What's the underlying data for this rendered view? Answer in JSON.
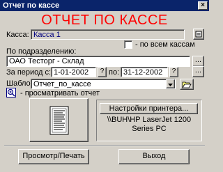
{
  "window": {
    "title": "Отчет по кассе",
    "close": "×"
  },
  "report_title": "ОТЧЕТ ПО КАССЕ",
  "cash": {
    "label": "Касса:",
    "value": "Касса 1"
  },
  "all_cash": {
    "label": "- по всем кассам",
    "checked": false
  },
  "division": {
    "label": "По подразделению:",
    "value": "ОАО Тесторг - Склад",
    "browse": "..."
  },
  "period": {
    "from_label": "За период с:",
    "from": "1-01-2002",
    "from_btn": "?",
    "to_label": "по:",
    "to": "31-12-2002",
    "to_btn": "?",
    "browse": "..."
  },
  "template": {
    "label": "Шаблон:",
    "value": "Отчет_по_кассе"
  },
  "preview": {
    "label": "- просматривать отчет"
  },
  "printer": {
    "settings_label": "Настройки принтера...",
    "name": "\\\\BUH\\HP LaserJet 1200 Series PC"
  },
  "buttons": {
    "print": "Просмотр/Печать",
    "exit": "Выход"
  },
  "colors": {
    "title_bar": "#0a246a",
    "report_title": "#ff0000",
    "field_text": "#000080",
    "face": "#d4d0c8"
  }
}
